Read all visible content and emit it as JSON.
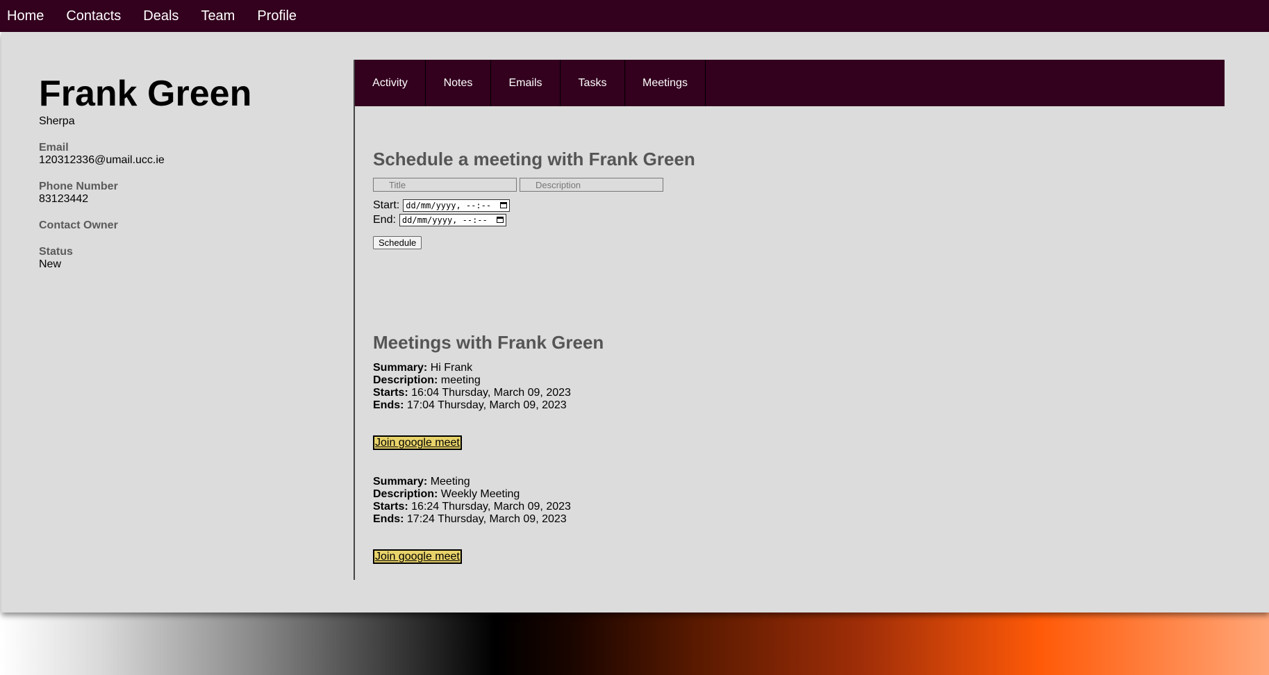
{
  "nav": {
    "items": [
      "Home",
      "Contacts",
      "Deals",
      "Team",
      "Profile"
    ]
  },
  "contact": {
    "name": "Frank Green",
    "role": "Sherpa",
    "email_label": "Email",
    "email": "120312336@umail.ucc.ie",
    "phone_label": "Phone Number",
    "phone": "83123442",
    "owner_label": "Contact Owner",
    "owner": "",
    "status_label": "Status",
    "status": "New"
  },
  "tabs": [
    "Activity",
    "Notes",
    "Emails",
    "Tasks",
    "Meetings"
  ],
  "schedule": {
    "heading": "Schedule a meeting with Frank Green",
    "title_placeholder": "Title",
    "description_placeholder": "Description",
    "start_label": "Start:",
    "end_label": "End:",
    "datetime_placeholder": "dd/mm/yyyy, --:--",
    "button_label": "Schedule"
  },
  "meetings": {
    "heading": "Meetings with Frank Green",
    "labels": {
      "summary": "Summary:",
      "description": "Description:",
      "starts": "Starts:",
      "ends": "Ends:"
    },
    "join_label": "Join google meet",
    "items": [
      {
        "summary": "Hi Frank",
        "description": "meeting",
        "starts": "16:04 Thursday, March 09, 2023",
        "ends": "17:04 Thursday, March 09, 2023"
      },
      {
        "summary": "Meeting",
        "description": "Weekly Meeting",
        "starts": "16:24 Thursday, March 09, 2023",
        "ends": "17:24 Thursday, March 09, 2023"
      }
    ]
  },
  "colors": {
    "nav_bg": "#33001e",
    "page_bg": "#dcdcdc",
    "heading": "#555555",
    "join_button_bg": "#e8d36a"
  }
}
